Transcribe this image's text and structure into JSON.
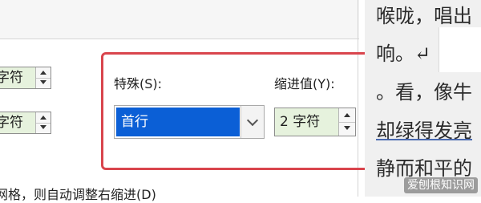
{
  "dialog": {
    "left_spins": [
      {
        "value": "字符"
      },
      {
        "value": "字符"
      }
    ],
    "special": {
      "label": "特殊(S):",
      "selected": "首行"
    },
    "indent": {
      "label": "缩进值(Y):",
      "value": "2 字符"
    },
    "bottom_text": "网格，则自动调整右缩进(D)"
  },
  "document": {
    "lines": [
      "喉咙，唱出",
      "响。↵",
      "。看，像牛",
      "却绿得发亮",
      "静而和平的"
    ]
  },
  "watermark": "爱刨根知识网",
  "colors": {
    "highlight_border": "#d9454d",
    "selection_bg": "#0b5fd6",
    "field_bg": "#e6f2dd"
  }
}
